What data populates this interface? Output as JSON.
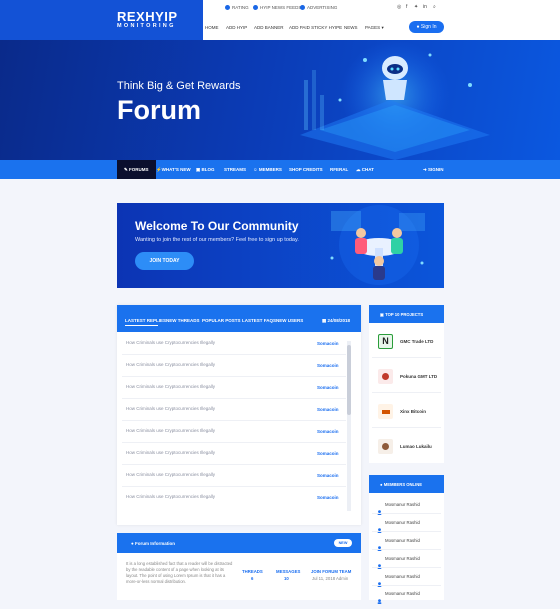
{
  "brand": {
    "title": "REXHYIP",
    "subtitle": "MONITORING"
  },
  "topbar": {
    "links": [
      "RATING",
      "HYIP NEWS FEEDS",
      "ADVERTISING"
    ],
    "social_icons": [
      "dribbble-icon",
      "facebook-icon",
      "twitter-icon",
      "linkedin-icon",
      "search-icon"
    ]
  },
  "nav": {
    "items": [
      "HOME",
      "ADD HYIP",
      "ADD BANNER",
      "ADD PAID STICKY HYIPE",
      "NEWS",
      "PAGES"
    ],
    "signin": "Sign In"
  },
  "hero": {
    "subtitle": "Think Big & Get Rewards",
    "title": "Forum"
  },
  "menu": {
    "items": [
      "FORUMS",
      "WHAT'S NEW",
      "BLOG",
      "STREAMS",
      "MEMBERS",
      "SHOP CREDITS",
      "RFERAL",
      "CHAT"
    ],
    "signin": "SIGNIN"
  },
  "welcome": {
    "title": "Welcome To Our Community",
    "description": "Wanting to join the rest of our members? Feel free to sign up today.",
    "button": "JOIN TODAY"
  },
  "forum": {
    "tabs": [
      "LASTEST REPLIES",
      "NEW THREADS",
      "POPULAR POSTS",
      "LASTEST FAQS",
      "NEW USERS"
    ],
    "date": "24/08/2018",
    "rows": [
      {
        "title": "How Criminals use Cryptocurrencies Illegally",
        "user": "Somacoin"
      },
      {
        "title": "How Criminals use Cryptocurrencies Illegally",
        "user": "Somacoin"
      },
      {
        "title": "How Criminals use Cryptocurrencies Illegally",
        "user": "Somacoin"
      },
      {
        "title": "How Criminals use Cryptocurrencies Illegally",
        "user": "Somacoin"
      },
      {
        "title": "How Criminals use Cryptocurrencies Illegally",
        "user": "Somacoin"
      },
      {
        "title": "How Criminals use Cryptocurrencies Illegally",
        "user": "Somacoin"
      },
      {
        "title": "How Criminals use Cryptocurrencies Illegally",
        "user": "Somacoin"
      },
      {
        "title": "How Criminals use Cryptocurrencies Illegally",
        "user": "Somacoin"
      }
    ]
  },
  "forum_info": {
    "title": "Forum Information",
    "badge": "NEW",
    "text": "It is a long established fact that a reader will be distracted by the readable content of a page when looking at its layout. The point of using Lorem Ipsum is that it has a more-or-less normal distribution.",
    "threads_label": "THREADS",
    "threads_value": "6",
    "messages_label": "MESSAGES",
    "messages_value": "10",
    "team_label": "JOIN FORUM TEAM",
    "team_value": "Jul 11, 2018 Admin"
  },
  "top_projects": {
    "title": "TOP 10 PROJECTS",
    "items": [
      {
        "name": "GMC Trade LTD",
        "logo_color": "#2a9d3a"
      },
      {
        "name": "Pokuna GMT LTD",
        "logo_color": "#c0392b"
      },
      {
        "name": "Xinx Bitcoin",
        "logo_color": "#d35400"
      },
      {
        "name": "Lumao Lukailu",
        "logo_color": "#8e5a3a"
      }
    ]
  },
  "members_online": {
    "title": "MEMBERS ONLINE",
    "items": [
      "Mosmanur Rashid",
      "Mosmanur Rashid",
      "Mosmanur Rashid",
      "Mosmanur Rashid",
      "Mosmanur Rashid",
      "Mosmanur Rashid"
    ]
  },
  "colors": {
    "primary": "#1a72ee",
    "dark": "#0b0f2e",
    "hero_dark": "#0a2a8a"
  }
}
